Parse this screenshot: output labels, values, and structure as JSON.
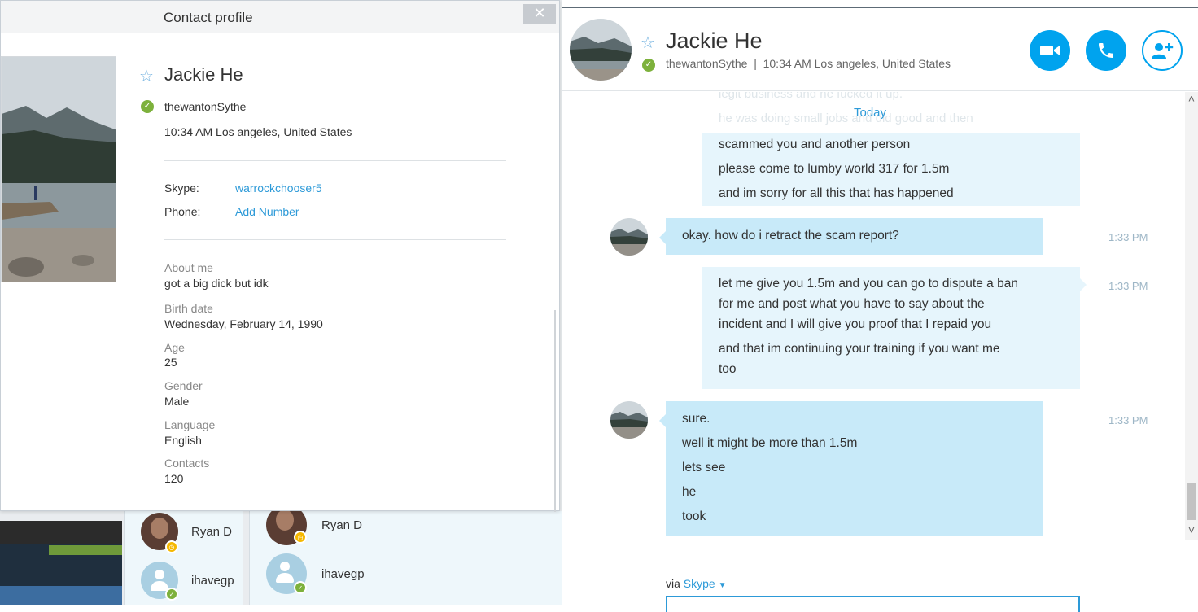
{
  "colors": {
    "accent": "#00a3ee",
    "link": "#2d9ad8",
    "online": "#7db13c",
    "away": "#f5b800",
    "bubble_in": "#c8eaf9",
    "bubble_out": "#e6f5fc"
  },
  "profile_dialog": {
    "title": "Contact profile",
    "close_label": "✕",
    "name": "Jackie He",
    "username": "thewantonSythe",
    "local_time": "10:34 AM Los angeles, United States",
    "skype_label": "Skype:",
    "skype_value": "warrockchooser5",
    "phone_label": "Phone:",
    "phone_value": "Add Number",
    "fields": [
      {
        "label": "About me",
        "value": "got a big dick but idk"
      },
      {
        "label": "Birth date",
        "value": "Wednesday, February 14, 1990"
      },
      {
        "label": "Age",
        "value": "25"
      },
      {
        "label": "Gender",
        "value": "Male"
      },
      {
        "label": "Language",
        "value": "English"
      },
      {
        "label": "Contacts",
        "value": "120"
      }
    ]
  },
  "contact_list_small": [
    {
      "name": "Ryan D",
      "status": "away"
    },
    {
      "name": "ihavegp",
      "status": "online"
    }
  ],
  "contact_list_large": [
    {
      "name": "Ryan D",
      "status": "away"
    },
    {
      "name": "ihavegp",
      "status": "online"
    }
  ],
  "chat": {
    "header": {
      "name": "Jackie He",
      "username": "thewantonSythe",
      "separator": "|",
      "location": "10:34 AM Los angeles, United States",
      "icons": [
        "video-call-icon",
        "voice-call-icon",
        "add-people-icon"
      ]
    },
    "faded_lines": [
      "legit business and he fucked it up.",
      "he was doing small jobs and did good and then"
    ],
    "date_divider": "Today",
    "messages": [
      {
        "direction": "outgoing",
        "lines": [
          "scammed you and another person",
          "please come to lumby world 317 for 1.5m",
          "and im sorry for all this that has happened"
        ],
        "time": ""
      },
      {
        "direction": "incoming",
        "lines": [
          "okay. how do i retract the scam report?"
        ],
        "time": "1:33 PM"
      },
      {
        "direction": "outgoing",
        "lines": [
          "let me give you 1.5m and you can go to dispute a ban",
          "for me and post what you have to say about the",
          "incident and I will give you proof that I repaid you",
          "and that im continuing your training if you want me",
          "too"
        ],
        "time": "1:33 PM"
      },
      {
        "direction": "incoming",
        "lines": [
          "sure.",
          "well it might be more than 1.5m",
          "lets see",
          "he",
          "took"
        ],
        "time": "1:33 PM"
      }
    ],
    "via_label": "via",
    "via_service": "Skype"
  }
}
